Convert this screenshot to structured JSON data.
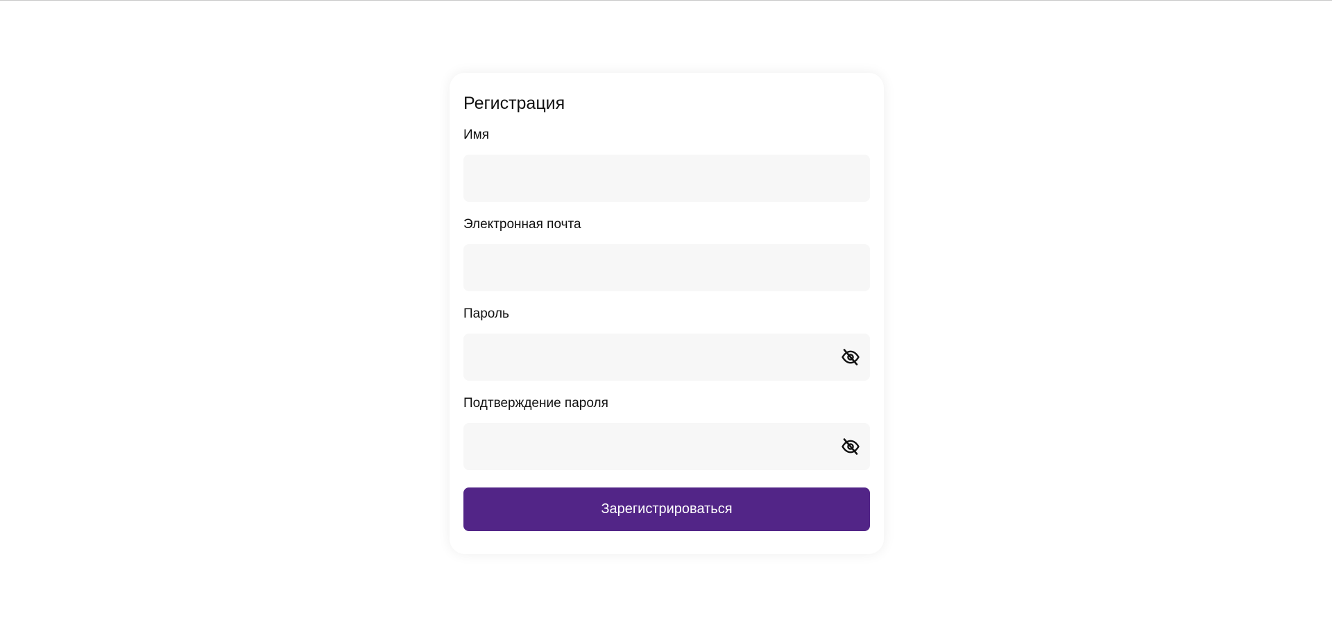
{
  "form": {
    "title": "Регистрация",
    "fields": [
      {
        "label": "Имя",
        "value": "",
        "type": "text"
      },
      {
        "label": "Электронная почта",
        "value": "",
        "type": "email"
      },
      {
        "label": "Пароль",
        "value": "",
        "type": "password",
        "toggle_icon": "eye-off-icon"
      },
      {
        "label": "Подтверждение пароля",
        "value": "",
        "type": "password",
        "toggle_icon": "eye-off-icon"
      }
    ],
    "submit_label": "Зарегистрироваться"
  },
  "colors": {
    "accent": "#522587",
    "input_background": "#f7f7f7",
    "card_background": "#ffffff",
    "text": "#111111"
  }
}
